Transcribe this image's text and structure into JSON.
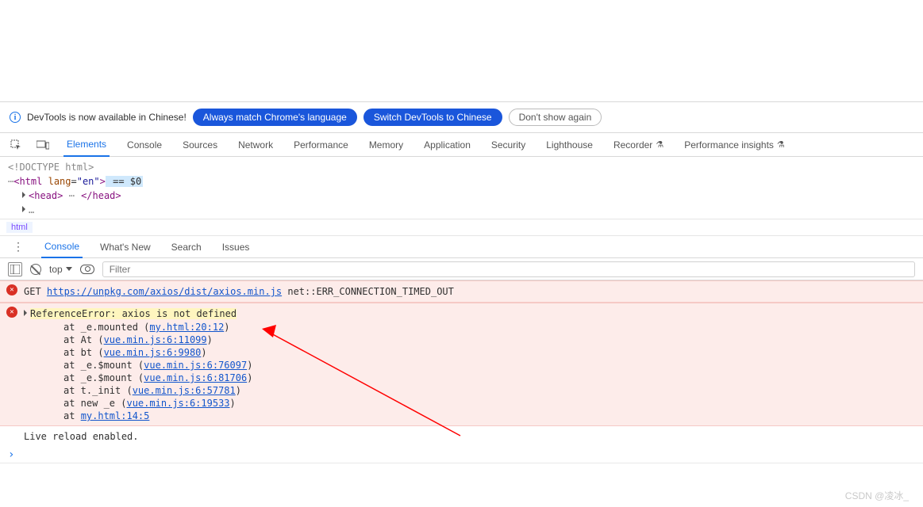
{
  "notice": {
    "text": "DevTools is now available in Chinese!",
    "always_match": "Always match Chrome's language",
    "switch": "Switch DevTools to Chinese",
    "dismiss": "Don't show again"
  },
  "tabs": {
    "elements": "Elements",
    "console": "Console",
    "sources": "Sources",
    "network": "Network",
    "performance": "Performance",
    "memory": "Memory",
    "application": "Application",
    "security": "Security",
    "lighthouse": "Lighthouse",
    "recorder": "Recorder",
    "perfinsights": "Performance insights"
  },
  "elements_tree": {
    "doctype": "<!DOCTYPE html>",
    "html_open": "<html lang=\"en\">",
    "eq": " == $0",
    "head_open": "<head>",
    "head_ellipsis": "⋯",
    "head_close": "</head>"
  },
  "breadcrumb": {
    "root": "html"
  },
  "drawer": {
    "console": "Console",
    "whatsnew": "What's New",
    "search": "Search",
    "issues": "Issues"
  },
  "toolbar": {
    "context": "top",
    "filter_placeholder": "Filter"
  },
  "console": {
    "get_label": "GET ",
    "get_url": "https://unpkg.com/axios/dist/axios.min.js",
    "get_tail": " net::ERR_CONNECTION_TIMED_OUT",
    "ref_error": "ReferenceError: axios is not defined",
    "stack": [
      {
        "pre": "at _e.mounted (",
        "link": "my.html:20:12",
        "post": ")"
      },
      {
        "pre": "at At (",
        "link": "vue.min.js:6:11099",
        "post": ")"
      },
      {
        "pre": "at bt (",
        "link": "vue.min.js:6:9980",
        "post": ")"
      },
      {
        "pre": "at _e.$mount (",
        "link": "vue.min.js:6:76097",
        "post": ")"
      },
      {
        "pre": "at _e.$mount (",
        "link": "vue.min.js:6:81706",
        "post": ")"
      },
      {
        "pre": "at t._init (",
        "link": "vue.min.js:6:57781",
        "post": ")"
      },
      {
        "pre": "at new _e (",
        "link": "vue.min.js:6:19533",
        "post": ")"
      },
      {
        "pre": "at ",
        "link": "my.html:14:5",
        "post": ""
      }
    ],
    "live_reload": "Live reload enabled."
  },
  "watermark": "CSDN @凌冰_"
}
